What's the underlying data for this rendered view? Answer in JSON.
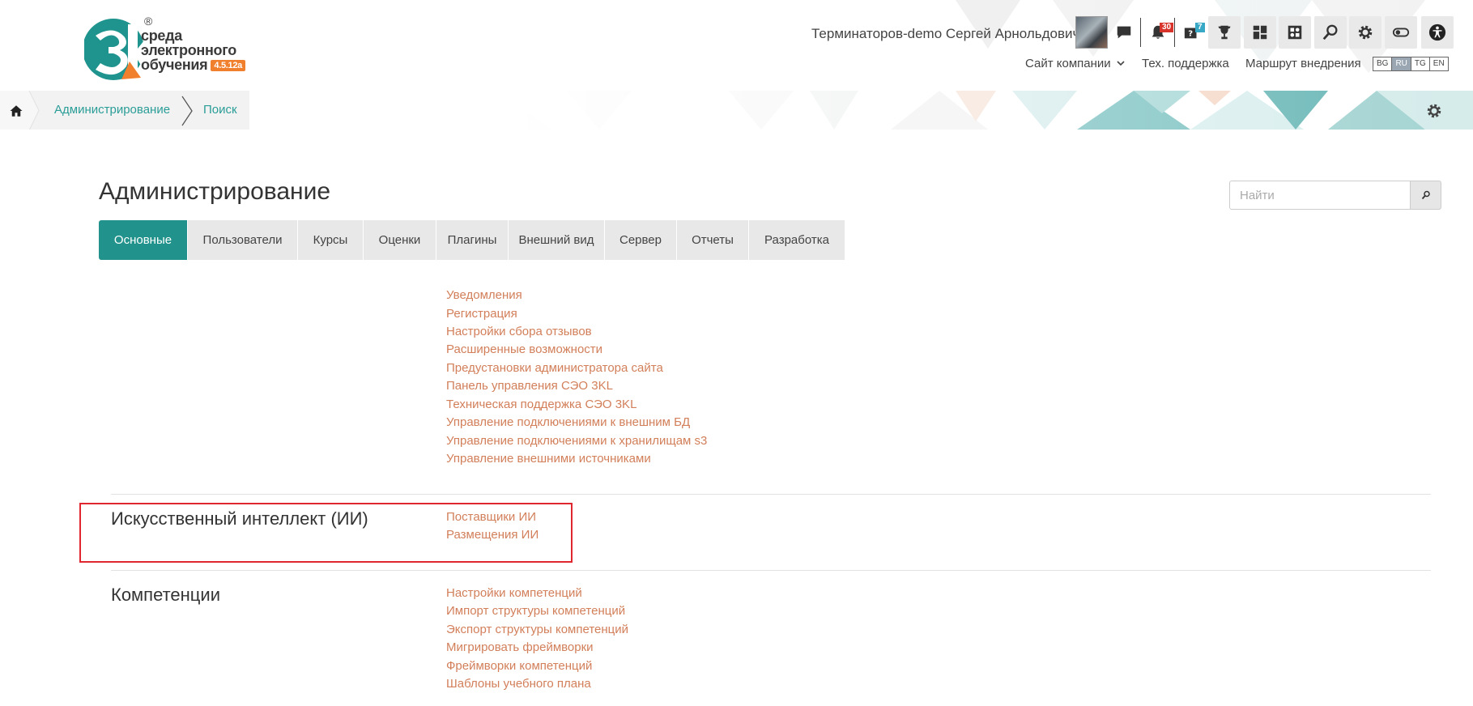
{
  "header": {
    "logo": {
      "line1": "среда",
      "line2": "электронного",
      "line3": "обучения",
      "version": "4.5.12a",
      "reg": "®"
    },
    "user_name": "Терминаторов-demo Сергей Арнольдович",
    "notifications_count": "30",
    "questions_count": "7",
    "links": {
      "company_site": "Сайт компании",
      "tech_support": "Тех. поддержка",
      "implementation_route": "Маршрут внедрения"
    },
    "languages": [
      "BG",
      "RU",
      "TG",
      "EN"
    ],
    "active_language": "RU",
    "icons": [
      "chat-icon",
      "bell-icon",
      "question-icon",
      "trophy-icon",
      "dashboard-icon",
      "grid-icon",
      "search-icon",
      "gear-icon",
      "toggle-icon",
      "accessibility-icon"
    ]
  },
  "breadcrumb": {
    "items": [
      "Администрирование",
      "Поиск"
    ]
  },
  "main": {
    "title": "Администрирование",
    "search_placeholder": "Найти",
    "tabs": [
      "Основные",
      "Пользователи",
      "Курсы",
      "Оценки",
      "Плагины",
      "Внешний вид",
      "Сервер",
      "Отчеты",
      "Разработка"
    ],
    "active_tab": "Основные",
    "sections": [
      {
        "title": "",
        "links": [
          "Уведомления",
          "Регистрация",
          "Настройки сбора отзывов",
          "Расширенные возможности",
          "Предустановки администратора сайта",
          "Панель управления СЭО 3KL",
          "Техническая поддержка СЭО 3KL",
          "Управление подключениями к внешним БД",
          "Управление подключениями к хранилищам s3",
          "Управление внешними источниками"
        ]
      },
      {
        "title": "Искусственный интеллект (ИИ)",
        "links": [
          "Поставщики ИИ",
          "Размещения ИИ"
        ]
      },
      {
        "title": "Компетенции",
        "links": [
          "Настройки компетенций",
          "Импорт структуры компетенций",
          "Экспорт структуры компетенций",
          "Мигрировать фреймворки",
          "Фреймворки компетенций",
          "Шаблоны учебного плана"
        ]
      }
    ]
  },
  "colors": {
    "accent": "#21938c",
    "link": "#d27f5a",
    "breadcrumb_link": "#2a9d97",
    "highlight": "#e0262f",
    "logo_orange": "#f07f2e"
  }
}
